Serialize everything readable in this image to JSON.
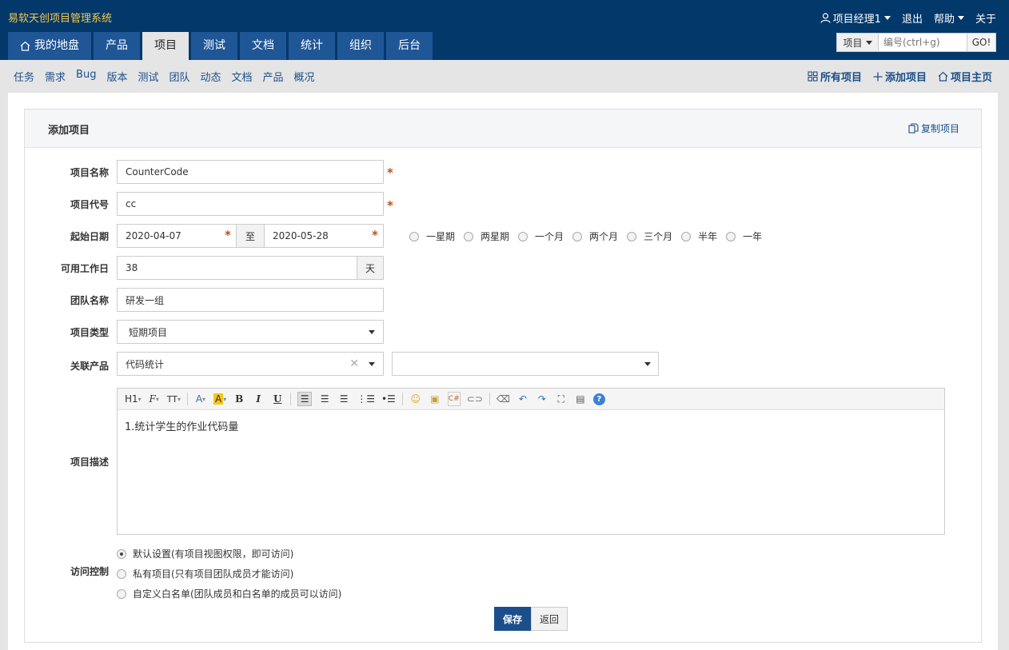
{
  "app": {
    "title": "易软天创项目管理系统"
  },
  "user_nav": {
    "user": "项目经理1",
    "logout": "退出",
    "help": "帮助",
    "about": "关于"
  },
  "main_tabs": [
    {
      "label": "我的地盘",
      "icon": "home-icon"
    },
    {
      "label": "产品"
    },
    {
      "label": "项目",
      "active": true
    },
    {
      "label": "测试"
    },
    {
      "label": "文档"
    },
    {
      "label": "统计"
    },
    {
      "label": "组织"
    },
    {
      "label": "后台"
    }
  ],
  "search": {
    "type": "项目",
    "placeholder": "编号(ctrl+g)",
    "go": "GO!"
  },
  "subnav": {
    "items": [
      "任务",
      "需求",
      "Bug",
      "版本",
      "测试",
      "团队",
      "动态",
      "文档",
      "产品",
      "概况"
    ],
    "all_projects": "所有项目",
    "add_project": "添加项目",
    "project_home": "项目主页"
  },
  "form": {
    "title": "添加项目",
    "copy_project": "复制项目",
    "labels": {
      "name": "项目名称",
      "code": "项目代号",
      "dates": "起始日期",
      "workdays": "可用工作日",
      "team": "团队名称",
      "type": "项目类型",
      "product": "关联产品",
      "description": "项目描述",
      "access": "访问控制"
    },
    "values": {
      "name": "CounterCode",
      "code": "cc",
      "begin": "2020-04-07",
      "to": "至",
      "end": "2020-05-28",
      "workdays": "38",
      "workdays_unit": "天",
      "team": "研发一组",
      "type": "短期项目",
      "product": "代码统计",
      "branch": "",
      "description": "1.统计学生的作业代码量"
    },
    "periods": [
      "一星期",
      "两星期",
      "一个月",
      "两个月",
      "三个月",
      "半年",
      "一年"
    ],
    "toolbar": {
      "heading": "H1",
      "font": "F",
      "size": "TT",
      "color": "A",
      "bg": "A",
      "bold": "B",
      "italic": "I",
      "underline": "U"
    },
    "access_options": [
      {
        "label": "默认设置(有项目视图权限，即可访问)",
        "checked": true
      },
      {
        "label": "私有项目(只有项目团队成员才能访问)",
        "checked": false
      },
      {
        "label": "自定义白名单(团队成员和白名单的成员可以访问)",
        "checked": false
      }
    ],
    "buttons": {
      "save": "保存",
      "back": "返回"
    }
  },
  "colors": {
    "header": "#03386b",
    "tab": "#1f5696",
    "brand": "#f4c84a",
    "primary": "#1a4f8b",
    "required": "#b5541e"
  }
}
